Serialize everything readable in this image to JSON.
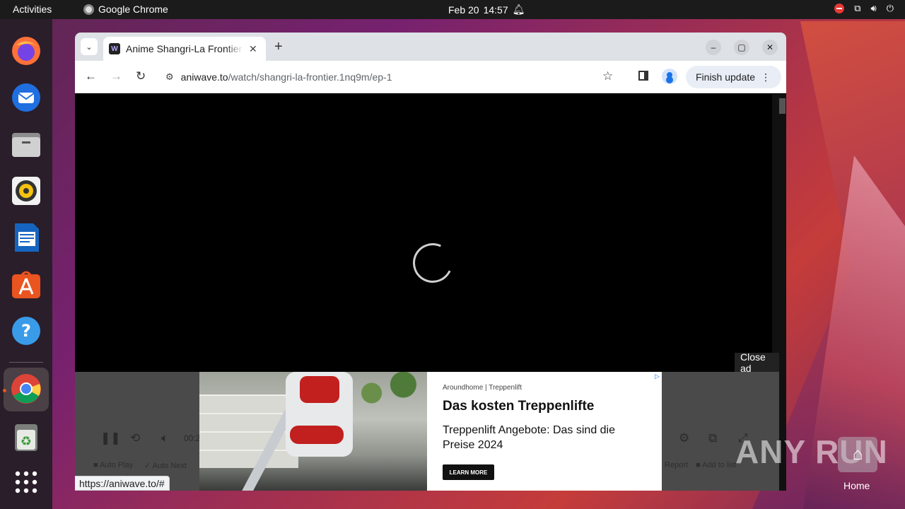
{
  "topbar": {
    "activities": "Activities",
    "app_name": "Google Chrome",
    "date": "Feb 20",
    "time": "14:57"
  },
  "dock": {
    "items": [
      "firefox-icon",
      "thunderbird-icon",
      "files-icon",
      "rhythmbox-icon",
      "writer-icon",
      "app-center-icon",
      "help-icon",
      "chrome-icon",
      "trash-icon",
      "app-grid-icon"
    ]
  },
  "browser": {
    "tab_title": "Anime Shangri-La Frontier",
    "favicon_letter": "W",
    "url_host": "aniwave.to",
    "url_path": "/watch/shangri-la-frontier.1nq9m/ep-1",
    "update_button": "Finish update",
    "status_url": "https://aniwave.to/#"
  },
  "player": {
    "time": "00:2",
    "auto_play": "Auto Play",
    "auto_next": "Auto Next",
    "report": "Report",
    "add_to_list": "Add to list",
    "close_ad": "Close ad"
  },
  "ad": {
    "sponsor": "Aroundhome | Treppenlift",
    "headline": "Das kosten Treppenlifte",
    "body": "Treppenlift Angebote: Das sind die Preise 2024",
    "cta": "LEARN MORE"
  },
  "desktop": {
    "watermark": "ANY RUN",
    "home_label": "Home"
  },
  "colors": {
    "ubuntu_orange": "#e95420",
    "topbar_bg": "#1b1b1b",
    "chrome_tabstrip": "#dee1e6"
  }
}
